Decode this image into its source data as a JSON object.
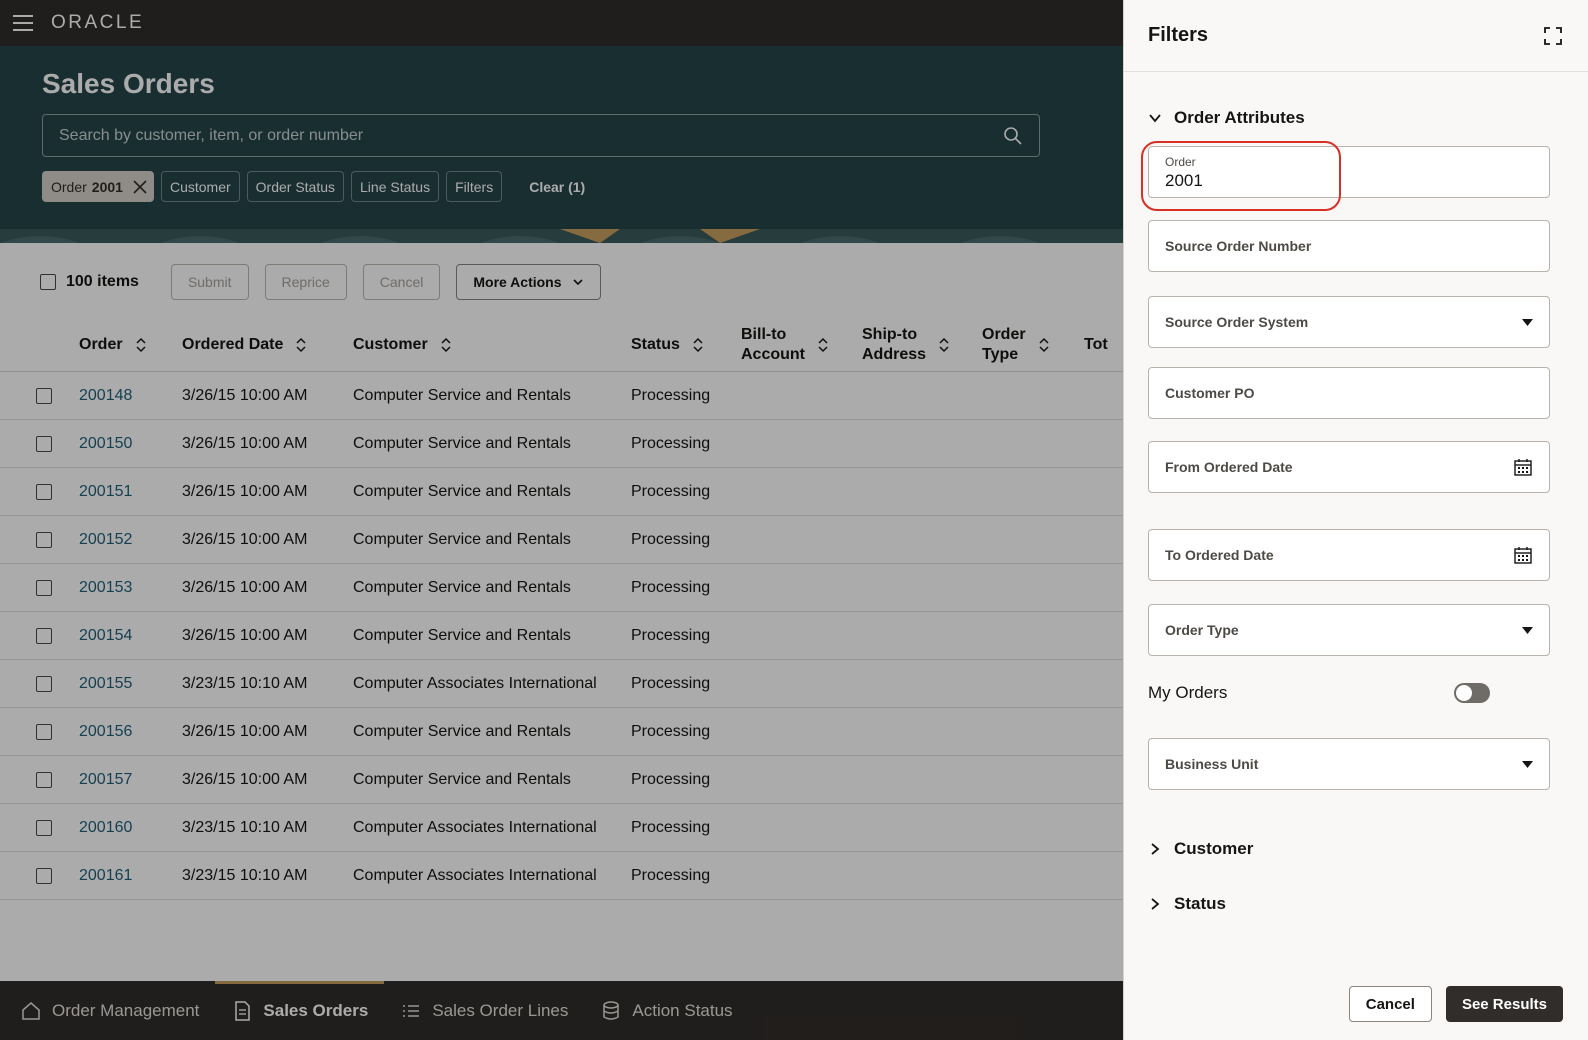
{
  "topbar": {
    "logo": "ORACLE"
  },
  "page": {
    "title": "Sales Orders",
    "search_placeholder": "Search by customer, item, or order number"
  },
  "chips": {
    "order_label": "Order",
    "order_value": "2001",
    "customer": "Customer",
    "order_status": "Order Status",
    "line_status": "Line Status",
    "filters": "Filters",
    "clear": "Clear (1)"
  },
  "toolbar": {
    "items_count": "100 items",
    "submit": "Submit",
    "reprice": "Reprice",
    "cancel": "Cancel",
    "more_actions": "More Actions"
  },
  "table": {
    "headers": {
      "order": "Order",
      "ordered_date": "Ordered Date",
      "customer": "Customer",
      "status": "Status",
      "bill_to_1": "Bill-to",
      "bill_to_2": "Account",
      "ship_to_1": "Ship-to",
      "ship_to_2": "Address",
      "order_type_1": "Order",
      "order_type_2": "Type",
      "total": "Tot"
    },
    "rows": [
      {
        "order": "200148",
        "date": "3/26/15 10:00 AM",
        "customer": "Computer Service and Rentals",
        "status": "Processing"
      },
      {
        "order": "200150",
        "date": "3/26/15 10:00 AM",
        "customer": "Computer Service and Rentals",
        "status": "Processing"
      },
      {
        "order": "200151",
        "date": "3/26/15 10:00 AM",
        "customer": "Computer Service and Rentals",
        "status": "Processing"
      },
      {
        "order": "200152",
        "date": "3/26/15 10:00 AM",
        "customer": "Computer Service and Rentals",
        "status": "Processing"
      },
      {
        "order": "200153",
        "date": "3/26/15 10:00 AM",
        "customer": "Computer Service and Rentals",
        "status": "Processing"
      },
      {
        "order": "200154",
        "date": "3/26/15 10:00 AM",
        "customer": "Computer Service and Rentals",
        "status": "Processing"
      },
      {
        "order": "200155",
        "date": "3/23/15 10:10 AM",
        "customer": "Computer Associates International",
        "status": "Processing"
      },
      {
        "order": "200156",
        "date": "3/26/15 10:00 AM",
        "customer": "Computer Service and Rentals",
        "status": "Processing"
      },
      {
        "order": "200157",
        "date": "3/26/15 10:00 AM",
        "customer": "Computer Service and Rentals",
        "status": "Processing"
      },
      {
        "order": "200160",
        "date": "3/23/15 10:10 AM",
        "customer": "Computer Associates International",
        "status": "Processing"
      },
      {
        "order": "200161",
        "date": "3/23/15 10:10 AM",
        "customer": "Computer Associates International",
        "status": "Processing"
      }
    ]
  },
  "bottom_nav": {
    "items": [
      "Order Management",
      "Sales Orders",
      "Sales Order Lines",
      "Action Status"
    ],
    "active": "Sales Orders"
  },
  "drawer": {
    "title": "Filters",
    "order_attributes": "Order Attributes",
    "order_label": "Order",
    "order_value": "2001",
    "source_order_number": "Source Order Number",
    "source_order_system": "Source Order System",
    "customer_po": "Customer PO",
    "from_ordered_date": "From Ordered Date",
    "to_ordered_date": "To Ordered Date",
    "order_type": "Order Type",
    "my_orders": "My Orders",
    "my_orders_on": false,
    "business_unit": "Business Unit",
    "customer_section": "Customer",
    "status_section": "Status",
    "cancel": "Cancel",
    "see_results": "See Results"
  },
  "colors": {
    "hero": "#26454a",
    "topbar": "#312d2a",
    "link": "#22607a",
    "highlight": "#d93025",
    "nav_active": "#c9a060"
  }
}
